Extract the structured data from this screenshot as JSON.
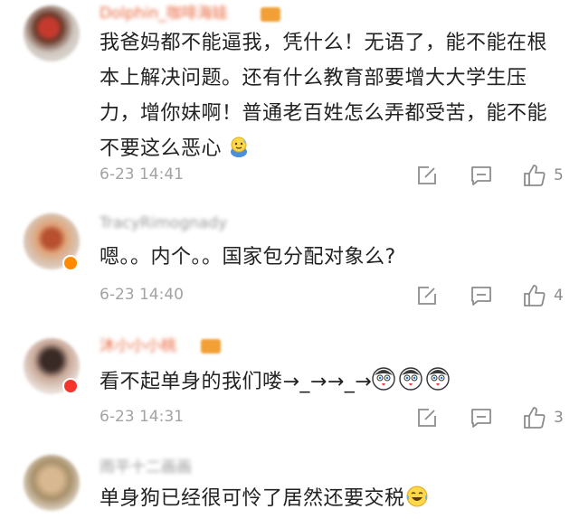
{
  "comments": [
    {
      "username": "Dolphin_咖啡海娃",
      "text_lines": [
        "我爸妈都不能逼我，凭什么！无语了，能不能在根",
        "本上解决问题。还有什么教育部要增大大学生压",
        "力，增你妹啊！普通老百姓怎么弄都受苦，能不能",
        "不要这么恶心"
      ],
      "trailing_emoji": "cold-sweat-emoji",
      "timestamp": "6-23 14:41",
      "likes": "5"
    },
    {
      "username": "TracyRimognady",
      "text": "嗯。。内个。。国家包分配对象么?",
      "timestamp": "6-23 14:40",
      "likes": "4"
    },
    {
      "username": "沐小小小桃",
      "text": "看不起单身的我们喽→_→→_→",
      "trailing_emoji": "husky-face-emoji",
      "timestamp": "6-23 14:31",
      "likes": "3"
    },
    {
      "username": "雨平十二画画",
      "text": "单身狗已经很可怜了居然还要交税",
      "trailing_emoji": "laughing-tears-emoji"
    }
  ],
  "colors": {
    "username_highlight": "#e8663d",
    "username_plain": "#9a9a9a",
    "timestamp": "#a3a3a3",
    "icon": "#8c8c8c",
    "text": "#222222"
  }
}
